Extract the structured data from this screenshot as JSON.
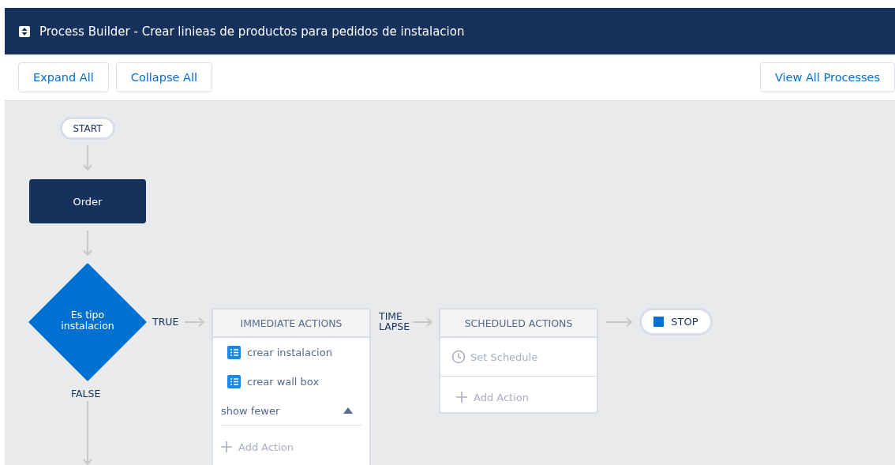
{
  "window": {
    "title": "Process Builder - Crear linieas de productos para pedidos de instalacion"
  },
  "toolbar": {
    "left_buttons": [
      "Expand All",
      "Collapse All"
    ],
    "right_button": "View All Processes"
  },
  "flow": {
    "start": "START",
    "object": "Order",
    "criteria": {
      "label": "Es tipo instalacion",
      "true_label": "TRUE",
      "false_label": "FALSE"
    },
    "immediate": {
      "title": "IMMEDIATE ACTIONS",
      "actions": [
        "crear instalacion",
        "crear wall box"
      ],
      "toggle": "show fewer",
      "expanded": true,
      "add_action": "Add Action"
    },
    "time_lapse_label": "TIME LAPSE",
    "scheduled": {
      "title": "SCHEDULED ACTIONS",
      "set_schedule": "Set Schedule",
      "add_action": "Add Action"
    },
    "stop": "STOP"
  }
}
